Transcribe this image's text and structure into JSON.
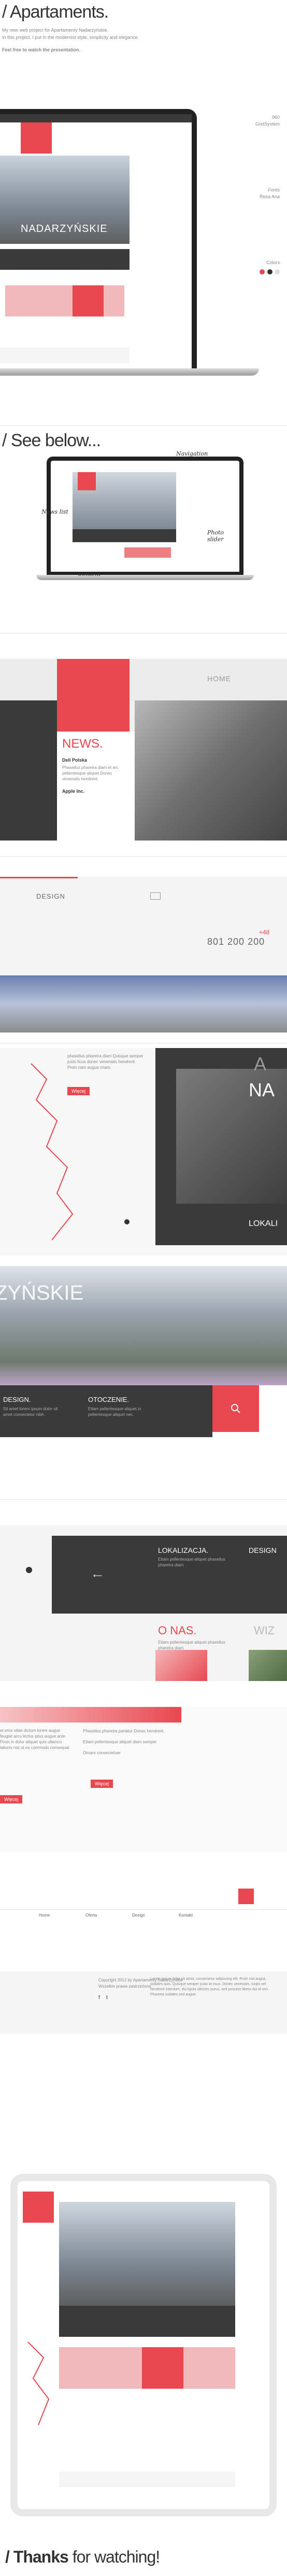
{
  "intro": {
    "title": "/ Apartaments.",
    "line1": "My new web project for Apartamenty Nadarzyńskie.",
    "line2": "In this project, I put in the modernist style, simplicity and elegance.",
    "line3": "Feel free to watch the presentation."
  },
  "laptop1": {
    "brand": "NADARZYŃSKIE",
    "grid_label": "960",
    "grid_label2": "GridSystem",
    "fonts_label": "Fonts",
    "fonts_value": "Rosa Ana",
    "colors_label": "Colors",
    "color_swatches": [
      "#e8474f",
      "#333333",
      "#dddddd"
    ]
  },
  "see_below": {
    "title": "/ See below...",
    "annotations": [
      "Navigation",
      "News list",
      "Photo slider",
      "Content"
    ]
  },
  "home_section": {
    "menu_home": "HOME",
    "news_title": "NEWS.",
    "news_item_title": "Deli Polska",
    "news_item_text": "Phasellus pharetra diam et arc pellentesque aliquet Donec venenatis hendrerit.",
    "news_link": "Apple Inc."
  },
  "design_section": {
    "label": "DESIGN",
    "phone_prefix": "+48",
    "phone": "801 200 200"
  },
  "map_section": {
    "text": "phasellus pharetra diam Quisque semper justo ficus donec venenatis hendrerit. Proin nam augue cnam.",
    "button": "Więcej",
    "right_top": "A",
    "right_top2": "NA",
    "right_bottom": "LOKALI"
  },
  "building_section": {
    "watermark": "ZYŃSKIE",
    "col1_title": "DESIGN.",
    "col1_text": "Sit amet lorem ipsum dolor sit amet consectetur nibh.",
    "col2_title": "OTOCZENIE.",
    "col2_text": "Etiam pellentesque aliquet in pellentesque aliquet nec."
  },
  "tiles_section": {
    "lokalizacja": "LOKALIZACJA.",
    "design": "DESIGN",
    "onas": "O NAS.",
    "wiz": "WIZ",
    "tile_text": "Etiam pellentesque aliquet phasellus pharetra diam"
  },
  "content_section": {
    "left_text": "et eros vitae dictum lorem augue feugiat arcu lectus iplus augue ante. Proin in dolor aliquet quis ullamco laboris nisi ut ex commodo consequat",
    "left_button": "Więcej",
    "bullets": [
      "Phasellus pharetra pariatur Donec hendrerit.",
      "Etiam pellentesque aliquet diam semper",
      "Ornare consectetuer"
    ],
    "button": "Więcej"
  },
  "footer_nav": {
    "items": [
      "Home",
      "Oferta",
      "Design",
      "Kontakt"
    ],
    "copyright": "Copyright 2012 by Apartamenty Nadarzyńskie",
    "rights": "Wszelkie prawa zastrzeżone.",
    "lorem": "Lorem ipsum dolor sit amet, consectetur adipiscing elit. Proin nisl augue, sodales quis. Quisque semper justo at risus. Donec venenatis, turpis vel hendrerit interdum, dui ligula ultricies purus, sed posuere libero dui id orci. Pharetra sodales sed augue."
  },
  "thanks": {
    "bold": "/ Thanks",
    "rest": "for watching!"
  }
}
